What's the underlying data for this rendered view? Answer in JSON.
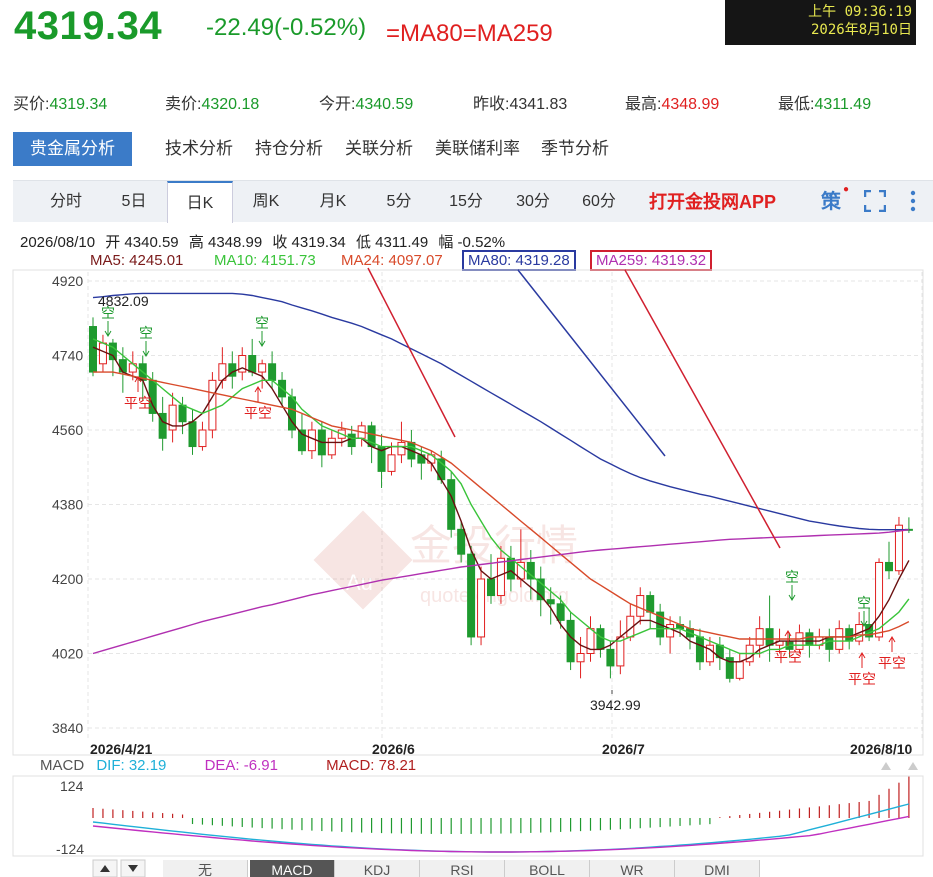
{
  "header": {
    "price": "4319.34",
    "change": "-22.49(-0.52%)",
    "ma_equal_text": "=MA80=MA259",
    "clock_line1": "上午 09:36:19",
    "clock_line2": "2026年8月10日"
  },
  "quotes": [
    {
      "label": "买价:",
      "value": "4319.34",
      "color": "green"
    },
    {
      "label": "卖价:",
      "value": "4320.18",
      "color": "green"
    },
    {
      "label": "今开:",
      "value": "4340.59",
      "color": "green"
    },
    {
      "label": "昨收:",
      "value": "4341.83",
      "color": "plain"
    },
    {
      "label": "最高:",
      "value": "4348.99",
      "color": "red"
    },
    {
      "label": "最低:",
      "value": "4311.49",
      "color": "green"
    }
  ],
  "main_tabs": [
    "贵金属分析",
    "技术分析",
    "持仓分析",
    "关联分析",
    "美联储利率",
    "季节分析"
  ],
  "period_tabs": [
    "分时",
    "5日",
    "日K",
    "周K",
    "月K",
    "5分",
    "15分",
    "30分",
    "60分"
  ],
  "period_active": "日K",
  "open_app": "打开金投网APP",
  "strategy_label": "策",
  "info_line": {
    "date": "2026/08/10",
    "open": "开 4340.59",
    "high": "高 4348.99",
    "close": "收 4319.34",
    "low": "低 4311.49",
    "amp": "幅 -0.52%"
  },
  "ma_labels": [
    {
      "text": "MA5: 4245.01",
      "color": "#7a1a1a"
    },
    {
      "text": "MA10: 4151.73",
      "color": "#3ac43a"
    },
    {
      "text": "MA24: 4097.07",
      "color": "#d84a2a"
    },
    {
      "text": "MA80: 4319.28",
      "color": "#2a3aa0",
      "boxed": true,
      "box_color": "#2a3aa0"
    },
    {
      "text": "MA259: 4319.32",
      "color": "#b030b0",
      "boxed": true,
      "box_color": "#d02030"
    }
  ],
  "chart_annotations": {
    "high_label": "4832.09",
    "low_label": "3942.99",
    "signals": [
      "空",
      "空",
      "空",
      "平空",
      "平空",
      "空",
      "平空",
      "空",
      "平空",
      "平空"
    ]
  },
  "watermark": {
    "brand": "金投行情",
    "url": "quote.cngold.org",
    "logo": "Au"
  },
  "macd": {
    "label": "MACD",
    "dif": "DIF: 32.19",
    "dea": "DEA: -6.91",
    "macd": "MACD: 78.21",
    "ticks": [
      "124",
      "-124"
    ]
  },
  "bottom_tabs": [
    "无",
    "MACD",
    "KDJ",
    "RSI",
    "BOLL",
    "WR",
    "DMI"
  ],
  "bottom_active": "MACD",
  "chart_data": {
    "type": "candlestick",
    "y_ticks": [
      "4920",
      "4740",
      "4560",
      "4380",
      "4200",
      "4020",
      "3840"
    ],
    "ylim": [
      3840,
      4920
    ],
    "x_ticks": [
      "2026/4/21",
      "2026/6",
      "2026/7",
      "2026/8/10"
    ],
    "candles": [
      [
        4810,
        4700,
        4832,
        4690
      ],
      [
        4720,
        4770,
        4790,
        4700
      ],
      [
        4770,
        4730,
        4780,
        4690
      ],
      [
        4730,
        4700,
        4760,
        4650
      ],
      [
        4700,
        4720,
        4750,
        4680
      ],
      [
        4720,
        4680,
        4740,
        4630
      ],
      [
        4680,
        4600,
        4700,
        4580
      ],
      [
        4600,
        4540,
        4640,
        4510
      ],
      [
        4560,
        4620,
        4650,
        4530
      ],
      [
        4620,
        4580,
        4640,
        4550
      ],
      [
        4580,
        4520,
        4610,
        4500
      ],
      [
        4520,
        4560,
        4580,
        4510
      ],
      [
        4560,
        4680,
        4700,
        4540
      ],
      [
        4680,
        4720,
        4760,
        4660
      ],
      [
        4720,
        4690,
        4750,
        4660
      ],
      [
        4700,
        4740,
        4760,
        4680
      ],
      [
        4740,
        4700,
        4780,
        4690
      ],
      [
        4700,
        4720,
        4730,
        4660
      ],
      [
        4720,
        4680,
        4750,
        4660
      ],
      [
        4680,
        4640,
        4700,
        4620
      ],
      [
        4640,
        4560,
        4660,
        4540
      ],
      [
        4560,
        4510,
        4600,
        4500
      ],
      [
        4510,
        4560,
        4580,
        4490
      ],
      [
        4560,
        4500,
        4580,
        4470
      ],
      [
        4500,
        4540,
        4560,
        4490
      ],
      [
        4540,
        4560,
        4580,
        4520
      ],
      [
        4550,
        4520,
        4570,
        4500
      ],
      [
        4540,
        4570,
        4580,
        4520
      ],
      [
        4570,
        4520,
        4580,
        4480
      ],
      [
        4520,
        4460,
        4550,
        4420
      ],
      [
        4460,
        4500,
        4530,
        4450
      ],
      [
        4500,
        4530,
        4580,
        4480
      ],
      [
        4530,
        4490,
        4560,
        4470
      ],
      [
        4500,
        4480,
        4520,
        4440
      ],
      [
        4480,
        4500,
        4510,
        4460
      ],
      [
        4490,
        4440,
        4510,
        4430
      ],
      [
        4440,
        4320,
        4460,
        4300
      ],
      [
        4320,
        4260,
        4340,
        4240
      ],
      [
        4260,
        4060,
        4280,
        4040
      ],
      [
        4060,
        4200,
        4230,
        4040
      ],
      [
        4200,
        4160,
        4260,
        4140
      ],
      [
        4160,
        4250,
        4280,
        4140
      ],
      [
        4250,
        4200,
        4280,
        4170
      ],
      [
        4200,
        4240,
        4320,
        4180
      ],
      [
        4240,
        4200,
        4270,
        4150
      ],
      [
        4200,
        4150,
        4230,
        4110
      ],
      [
        4150,
        4140,
        4180,
        4090
      ],
      [
        4140,
        4100,
        4160,
        4080
      ],
      [
        4100,
        4000,
        4120,
        3980
      ],
      [
        4000,
        4020,
        4060,
        3960
      ],
      [
        4020,
        4080,
        4110,
        4000
      ],
      [
        4080,
        4030,
        4090,
        4010
      ],
      [
        4030,
        3990,
        4050,
        3960
      ],
      [
        3990,
        4060,
        4100,
        3970
      ],
      [
        4060,
        4110,
        4140,
        4050
      ],
      [
        4110,
        4160,
        4180,
        4090
      ],
      [
        4160,
        4120,
        4170,
        4080
      ],
      [
        4120,
        4060,
        4140,
        4040
      ],
      [
        4060,
        4090,
        4110,
        4020
      ],
      [
        4090,
        4080,
        4110,
        4060
      ],
      [
        4080,
        4060,
        4100,
        4030
      ],
      [
        4060,
        4000,
        4080,
        3980
      ],
      [
        4000,
        4040,
        4060,
        3990
      ],
      [
        4040,
        4010,
        4060,
        3980
      ],
      [
        4010,
        3960,
        4030,
        3950
      ],
      [
        3960,
        4000,
        4020,
        3955
      ],
      [
        4000,
        4040,
        4060,
        3990
      ],
      [
        4040,
        4080,
        4110,
        4010
      ],
      [
        4080,
        4040,
        4160,
        4000
      ],
      [
        4040,
        4050,
        4080,
        4020
      ],
      [
        4050,
        4030,
        4070,
        4010
      ],
      [
        4030,
        4070,
        4090,
        4020
      ],
      [
        4070,
        4040,
        4080,
        4010
      ],
      [
        4040,
        4060,
        4080,
        4030
      ],
      [
        4060,
        4030,
        4080,
        4000
      ],
      [
        4030,
        4080,
        4100,
        4020
      ],
      [
        4080,
        4050,
        4090,
        4030
      ],
      [
        4050,
        4090,
        4120,
        4040
      ],
      [
        4090,
        4060,
        4130,
        4050
      ],
      [
        4060,
        4240,
        4250,
        4050
      ],
      [
        4240,
        4220,
        4290,
        4200
      ],
      [
        4220,
        4330,
        4350,
        4210
      ],
      [
        4320,
        4319,
        4349,
        4311
      ]
    ],
    "series": [
      {
        "name": "MA5",
        "values": [
          4760,
          4750,
          4740,
          4700,
          4690,
          4680,
          4620,
          4580,
          4570,
          4570,
          4580,
          4600,
          4640,
          4680,
          4700,
          4710,
          4700,
          4690,
          4660,
          4620,
          4580,
          4550,
          4540,
          4530,
          4530,
          4530,
          4540,
          4540,
          4520,
          4510,
          4520,
          4520,
          4510,
          4500,
          4480,
          4440,
          4400,
          4340,
          4270,
          4220,
          4200,
          4210,
          4220,
          4200,
          4180,
          4160,
          4130,
          4090,
          4060,
          4040,
          4030,
          4030,
          4040,
          4060,
          4080,
          4100,
          4100,
          4090,
          4080,
          4070,
          4050,
          4040,
          4030,
          4010,
          4000,
          4000,
          4010,
          4030,
          4040,
          4050,
          4050,
          4050,
          4050,
          4050,
          4060,
          4060,
          4060,
          4070,
          4080,
          4110,
          4150,
          4200,
          4245
        ]
      },
      {
        "name": "MA10",
        "values": [
          4780,
          4770,
          4760,
          4740,
          4720,
          4700,
          4680,
          4660,
          4640,
          4620,
          4610,
          4600,
          4610,
          4620,
          4640,
          4660,
          4670,
          4680,
          4680,
          4660,
          4640,
          4610,
          4590,
          4570,
          4560,
          4550,
          4540,
          4540,
          4530,
          4520,
          4520,
          4520,
          4520,
          4510,
          4500,
          4480,
          4460,
          4430,
          4380,
          4340,
          4300,
          4270,
          4250,
          4230,
          4210,
          4190,
          4170,
          4150,
          4120,
          4100,
          4080,
          4060,
          4050,
          4050,
          4060,
          4070,
          4080,
          4080,
          4080,
          4080,
          4070,
          4060,
          4050,
          4040,
          4030,
          4020,
          4020,
          4020,
          4030,
          4030,
          4040,
          4040,
          4040,
          4040,
          4050,
          4050,
          4050,
          4060,
          4070,
          4080,
          4100,
          4120,
          4152
        ]
      },
      {
        "name": "MA24",
        "values": [
          4700,
          4700,
          4700,
          4695,
          4690,
          4685,
          4680,
          4675,
          4670,
          4665,
          4660,
          4655,
          4650,
          4645,
          4640,
          4635,
          4630,
          4625,
          4620,
          4615,
          4610,
          4600,
          4590,
          4580,
          4570,
          4565,
          4560,
          4555,
          4550,
          4545,
          4540,
          4535,
          4530,
          4520,
          4510,
          4495,
          4480,
          4460,
          4440,
          4420,
          4400,
          4380,
          4360,
          4340,
          4320,
          4300,
          4280,
          4260,
          4240,
          4220,
          4200,
          4185,
          4170,
          4155,
          4140,
          4130,
          4120,
          4110,
          4100,
          4090,
          4080,
          4075,
          4070,
          4065,
          4060,
          4055,
          4055,
          4055,
          4055,
          4055,
          4055,
          4055,
          4060,
          4060,
          4060,
          4060,
          4060,
          4065,
          4065,
          4070,
          4075,
          4085,
          4097
        ]
      },
      {
        "name": "MA80",
        "values": [
          4880,
          4882,
          4885,
          4887,
          4889,
          4890,
          4890,
          4890,
          4890,
          4890,
          4890,
          4890,
          4890,
          4890,
          4890,
          4888,
          4885,
          4880,
          4875,
          4870,
          4862,
          4855,
          4848,
          4840,
          4832,
          4825,
          4818,
          4810,
          4800,
          4790,
          4780,
          4768,
          4756,
          4744,
          4732,
          4720,
          4706,
          4692,
          4678,
          4664,
          4650,
          4636,
          4622,
          4608,
          4594,
          4580,
          4565,
          4550,
          4535,
          4520,
          4505,
          4490,
          4478,
          4466,
          4455,
          4445,
          4437,
          4430,
          4423,
          4417,
          4411,
          4405,
          4400,
          4394,
          4388,
          4382,
          4376,
          4370,
          4364,
          4358,
          4352,
          4346,
          4340,
          4336,
          4332,
          4328,
          4325,
          4322,
          4320,
          4319,
          4319,
          4319,
          4319
        ]
      },
      {
        "name": "MA259",
        "values": [
          4020,
          4027,
          4034,
          4041,
          4048,
          4055,
          4062,
          4069,
          4076,
          4083,
          4090,
          4097,
          4103,
          4109,
          4115,
          4121,
          4127,
          4133,
          4138,
          4144,
          4150,
          4156,
          4162,
          4167,
          4172,
          4177,
          4182,
          4187,
          4192,
          4197,
          4201,
          4205,
          4209,
          4213,
          4217,
          4221,
          4225,
          4229,
          4232,
          4235,
          4238,
          4241,
          4244,
          4247,
          4250,
          4253,
          4256,
          4259,
          4262,
          4265,
          4268,
          4270,
          4272,
          4274,
          4276,
          4278,
          4280,
          4282,
          4284,
          4286,
          4288,
          4290,
          4292,
          4294,
          4296,
          4297,
          4298,
          4299,
          4300,
          4301,
          4302,
          4303,
          4304,
          4305,
          4306,
          4307,
          4308,
          4309,
          4310,
          4311,
          4313,
          4316,
          4319
        ]
      }
    ]
  }
}
